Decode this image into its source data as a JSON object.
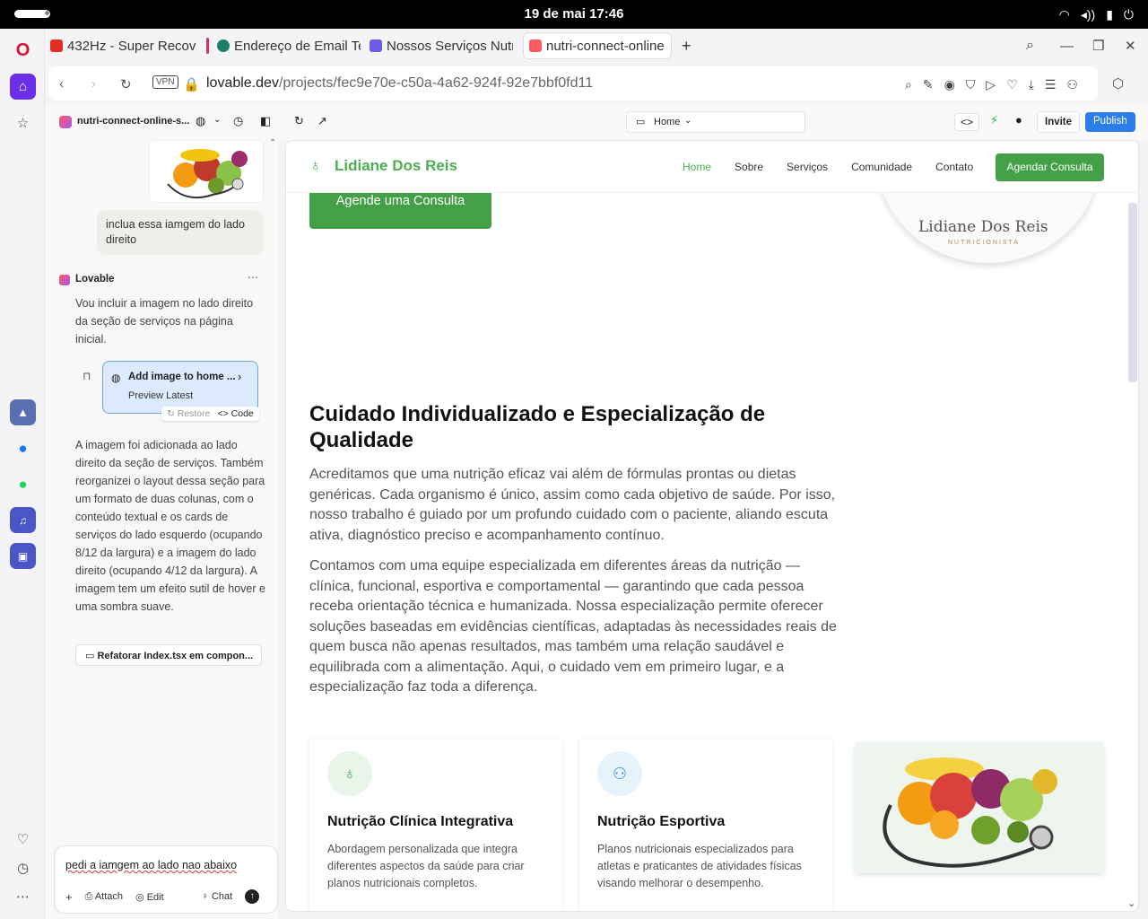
{
  "system": {
    "clock": "19 de mai  17:46"
  },
  "tabs": [
    {
      "label": "432Hz - Super Recov",
      "color": "#e52d27"
    },
    {
      "label": "Endereço de Email Te",
      "color": "#1b7f6b"
    },
    {
      "label": "Nossos Serviços Nutri",
      "color": "#6c5ce7"
    },
    {
      "label": "nutri-connect-online",
      "color": "#ff5a5f"
    }
  ],
  "address": {
    "vpn": "VPN",
    "host": "lovable.dev",
    "path": "/projects/fec9e70e-c50a-4a62-924f-92e7bbf0fd11"
  },
  "lovable_top": {
    "project": "nutri-connect-online-s...",
    "page_select": "Home",
    "invite": "Invite",
    "publish": "Publish"
  },
  "chat": {
    "user_msg": "inclua essa iamgem do lado direito",
    "assistant_name": "Lovable",
    "msg1": "Vou incluir a imagem no lado direito da seção de serviços na página inicial.",
    "card_title": "Add image to home ...",
    "card_sub": "Preview Latest",
    "restore": "Restore",
    "code": "Code",
    "msg2": "A imagem foi adicionada ao lado direito da seção de serviços. Também reorganizei o layout dessa seção para um formato de duas colunas, com o conteúdo textual e os cards de serviços do lado esquerdo (ocupando 8/12 da largura) e a imagem do lado direito (ocupando 4/12 da largura). A imagem tem um efeito sutil de hover e uma sombra suave.",
    "refactor": "Refatorar Index.tsx em compon...",
    "input_value": "pedi a iamgem ao lado nao abaixo",
    "attach": "Attach",
    "edit": "Edit",
    "chat_btn": "Chat"
  },
  "site": {
    "brand": "Lidiane Dos Reis",
    "nav": [
      "Home",
      "Sobre",
      "Serviços",
      "Comunidade",
      "Contato"
    ],
    "nav_cta": "Agendar Consulta",
    "hero_cta": "Agende uma Consulta",
    "logo_name": "Lidiane Dos Reis",
    "logo_sub": "NUTRICIONISTA",
    "heading": "Cuidado Individualizado e Especialização de Qualidade",
    "p1": "Acreditamos que uma nutrição eficaz vai além de fórmulas prontas ou dietas genéricas. Cada organismo é único, assim como cada objetivo de saúde. Por isso, nosso trabalho é guiado por um profundo cuidado com o paciente, aliando escuta ativa, diagnóstico preciso e acompanhamento contínuo.",
    "p2": "Contamos com uma equipe especializada em diferentes áreas da nutrição — clínica, funcional, esportiva e comportamental — garantindo que cada pessoa receba orientação técnica e humanizada. Nossa especialização permite oferecer soluções baseadas em evidências científicas, adaptadas às necessidades reais de quem busca não apenas resultados, mas também uma relação saudável e equilibrada com a alimentação. Aqui, o cuidado vem em primeiro lugar, e a especialização faz toda a diferença.",
    "services": [
      {
        "title": "Nutrição Clínica Integrativa",
        "desc": "Abordagem personalizada que integra diferentes aspectos da saúde para criar planos nutricionais completos."
      },
      {
        "title": "Nutrição Esportiva",
        "desc": "Planos nutricionais especializados para atletas e praticantes de atividades físicas visando melhorar o desempenho."
      }
    ]
  },
  "colors": {
    "brand_green": "#43a047",
    "publish_blue": "#2b7de9"
  }
}
